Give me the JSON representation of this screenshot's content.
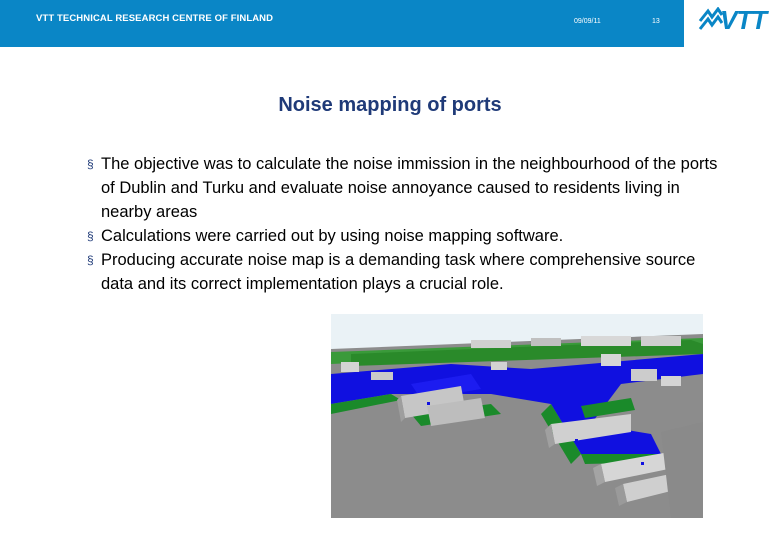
{
  "header": {
    "organization": "VTT TECHNICAL RESEARCH CENTRE OF FINLAND",
    "date": "09/09/11",
    "page_number": "13",
    "logo_text": "VTT",
    "background_color": "#0a86c6"
  },
  "slide": {
    "title": "Noise mapping of ports",
    "bullets": [
      "The objective was to calculate the noise immission in the neighbourhood of the ports of Dublin and Turku and evaluate noise annoyance caused to residents living in nearby areas",
      "Calculations were carried out by using noise mapping software.",
      "Producing accurate noise map is a demanding task where comprehensive source data and its correct implementation plays a crucial role."
    ],
    "bullet_marker": "§"
  },
  "image": {
    "description_icon": "3d-port-noise-map-render",
    "colors": {
      "sky": "#eaf2f6",
      "ground": "#8a8a8a",
      "water": "#1010e0",
      "grass": "#1a8a2a",
      "building": "#c8c8c8"
    }
  }
}
